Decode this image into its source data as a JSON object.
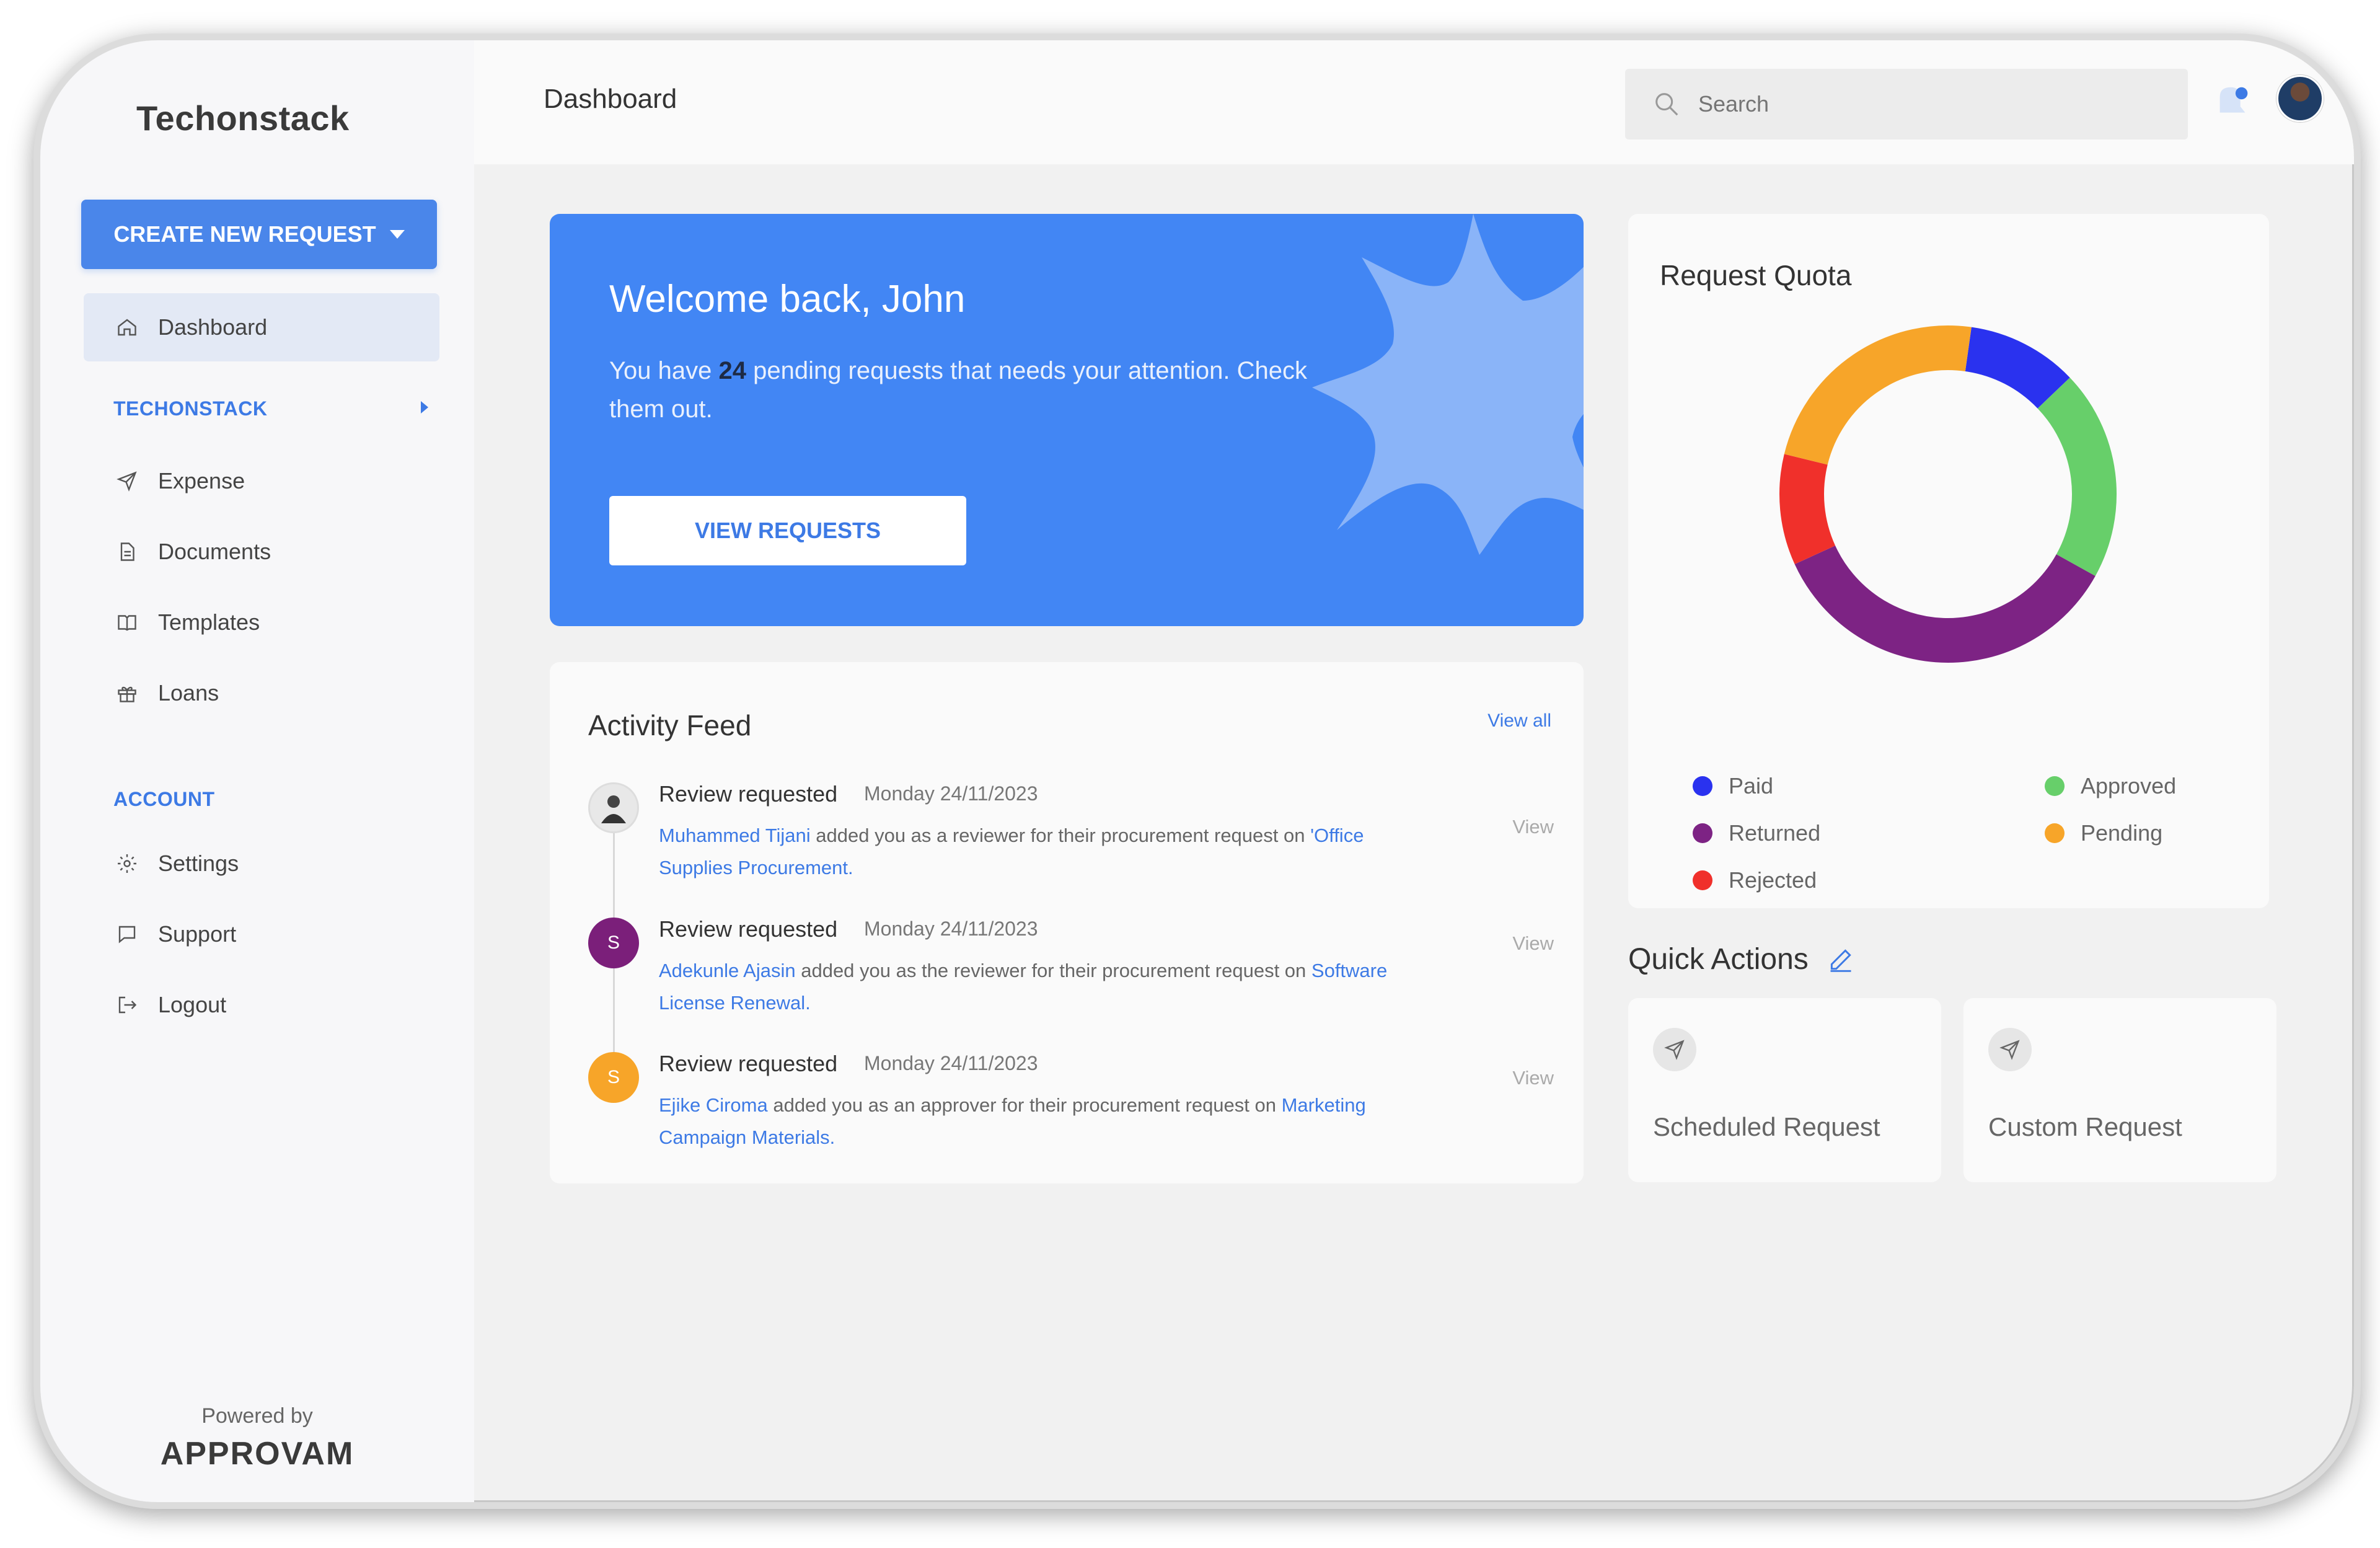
{
  "app": {
    "brand": "Techonstack",
    "powered_by": "Powered by",
    "powered_brand": "APPROVAM"
  },
  "sidebar": {
    "create_button": "CREATE NEW REQUEST",
    "items": [
      {
        "label": "Dashboard",
        "icon": "home-icon"
      },
      {
        "label": "Expense",
        "icon": "send-icon"
      },
      {
        "label": "Documents",
        "icon": "document-icon"
      },
      {
        "label": "Templates",
        "icon": "book-icon"
      },
      {
        "label": "Loans",
        "icon": "gift-icon"
      },
      {
        "label": "Settings",
        "icon": "gear-icon"
      },
      {
        "label": "Support",
        "icon": "chat-icon"
      },
      {
        "label": "Logout",
        "icon": "logout-icon"
      }
    ],
    "sections": {
      "org": "TECHONSTACK",
      "account": "ACCOUNT"
    }
  },
  "header": {
    "title": "Dashboard",
    "search_placeholder": "Search"
  },
  "welcome": {
    "title": "Welcome back, John",
    "text_before": "You have ",
    "pending_count": "24",
    "text_after": " pending requests that needs your attention. Check them out.",
    "button": "VIEW REQUESTS"
  },
  "feed": {
    "title": "Activity Feed",
    "view_all": "View all",
    "items": [
      {
        "heading": "Review requested",
        "date": "Monday 24/11/2023",
        "user": "Muhammed Tijani",
        "action": " added you as a reviewer for their procurement request on ",
        "target": "'Office Supplies Procurement.",
        "view": "View",
        "avatar": "",
        "avatar_color": "#dddddd"
      },
      {
        "heading": "Review requested",
        "date": "Monday 24/11/2023",
        "user": "Adekunle Ajasin",
        "action": " added you as the reviewer for their procurement request on ",
        "target": "Software License Renewal.",
        "view": "View",
        "avatar": "S",
        "avatar_color": "#7b1f7a"
      },
      {
        "heading": "Review requested",
        "date": "Monday 24/11/2023",
        "user": "Ejike Ciroma",
        "action": " added you as an approver for their procurement request on ",
        "target": "Marketing Campaign Materials.",
        "view": "View",
        "avatar": "S",
        "avatar_color": "#f7a529"
      }
    ]
  },
  "quota": {
    "title": "Request Quota"
  },
  "chart_data": {
    "type": "pie",
    "categories": [
      "Paid",
      "Approved",
      "Returned",
      "Pending",
      "Rejected"
    ],
    "values": [
      10,
      19,
      33,
      22,
      10
    ],
    "colors": {
      "Paid": "#2a32ef",
      "Approved": "#67cf6a",
      "Returned": "#7d2384",
      "Pending": "#f7a529",
      "Rejected": "#f0302b"
    },
    "legend": "bottom"
  },
  "quick_actions": {
    "title": "Quick Actions",
    "cards": [
      {
        "label": "Scheduled Request",
        "icon": "send-icon"
      },
      {
        "label": "Custom Request",
        "icon": "send-icon"
      }
    ]
  },
  "colors": {
    "accent": "#4286f4",
    "link": "#3d7ae5"
  }
}
